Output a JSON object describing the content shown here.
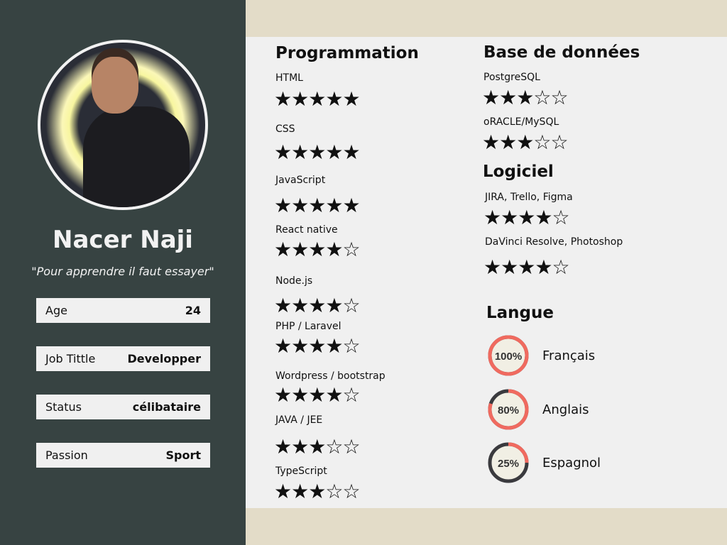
{
  "profile": {
    "name": "Nacer Naji",
    "quote": "\"Pour apprendre il faut essayer\"",
    "info": [
      {
        "label": "Age",
        "value": "24"
      },
      {
        "label": "Job Tittle",
        "value": "Developper"
      },
      {
        "label": "Status",
        "value": "célibataire"
      },
      {
        "label": "Passion",
        "value": "Sport"
      }
    ]
  },
  "programmation": {
    "title": "Programmation",
    "items": [
      {
        "label": "HTML",
        "rating": 5
      },
      {
        "label": "CSS",
        "rating": 5
      },
      {
        "label": "JavaScript",
        "rating": 5
      },
      {
        "label": "React native",
        "rating": 4
      },
      {
        "label": "Node.js",
        "rating": 4
      },
      {
        "label": "PHP / Laravel",
        "rating": 4
      },
      {
        "label": "Wordpress / bootstrap",
        "rating": 4
      },
      {
        "label": "JAVA / JEE",
        "rating": 3
      },
      {
        "label": "TypeScript",
        "rating": 3
      }
    ]
  },
  "database": {
    "title": "Base de données",
    "items": [
      {
        "label": "PostgreSQL",
        "rating": 3
      },
      {
        "label": "oRACLE/MySQL",
        "rating": 3
      }
    ]
  },
  "software": {
    "title": "Logiciel",
    "items": [
      {
        "label": "JIRA, Trello, Figma",
        "rating": 4
      },
      {
        "label": "DaVinci Resolve, Photoshop",
        "rating": 4
      }
    ]
  },
  "languages": {
    "title": "Langue",
    "items": [
      {
        "label": "Français",
        "percent": 100,
        "text": "100%"
      },
      {
        "label": "Anglais",
        "percent": 80,
        "text": "80%"
      },
      {
        "label": "Espagnol",
        "percent": 25,
        "text": "25%"
      }
    ]
  },
  "colors": {
    "sidebar": "#374342",
    "band": "#e3dcc8",
    "ring": "#f06a5f",
    "ringTrack": "#3a3a3e"
  }
}
